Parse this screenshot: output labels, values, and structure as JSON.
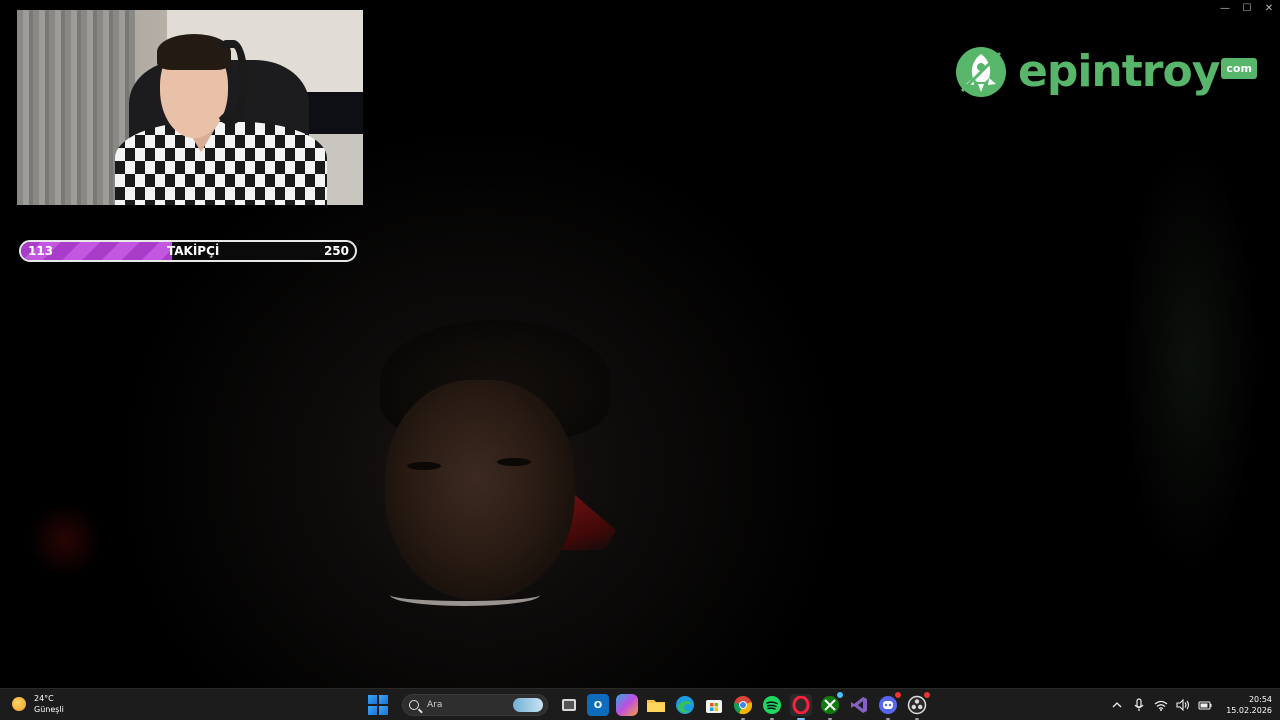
{
  "window": {
    "minimize_glyph": "—",
    "maximize_glyph": "☐",
    "close_glyph": "✕"
  },
  "goal": {
    "current": "113",
    "label": "TAKİPÇİ",
    "target": "250",
    "progress_fraction": 0.452,
    "fill_color": "#a93cc9"
  },
  "brand": {
    "name": "epintroy",
    "tld": "com",
    "color": "#57b66a",
    "icon": "rocket-icon"
  },
  "taskbar": {
    "weather": {
      "temperature": "24°C",
      "condition": "Güneşli",
      "icon": "sun-icon"
    },
    "search": {
      "placeholder": "Ara",
      "icon": "search-icon"
    },
    "apps": [
      {
        "name": "task-view",
        "icon": "task-view-icon"
      },
      {
        "name": "outlook",
        "icon": "outlook-icon"
      },
      {
        "name": "copilot",
        "icon": "copilot-icon"
      },
      {
        "name": "file-explorer",
        "icon": "folder-icon"
      },
      {
        "name": "edge",
        "icon": "edge-icon"
      },
      {
        "name": "store",
        "icon": "store-icon"
      },
      {
        "name": "chrome",
        "icon": "chrome-icon"
      },
      {
        "name": "spotify",
        "icon": "spotify-icon"
      },
      {
        "name": "opera-gx",
        "icon": "opera-icon"
      },
      {
        "name": "xbox",
        "icon": "xbox-icon"
      },
      {
        "name": "visual-studio",
        "icon": "visual-studio-icon"
      },
      {
        "name": "discord",
        "icon": "discord-icon"
      },
      {
        "name": "obs-studio",
        "icon": "obs-icon"
      }
    ],
    "clock": {
      "time": "20:54",
      "date": "15.02.2026"
    },
    "tray": [
      "chevron-up-icon",
      "microphone-icon",
      "wifi-icon",
      "speaker-icon",
      "battery-icon"
    ]
  }
}
